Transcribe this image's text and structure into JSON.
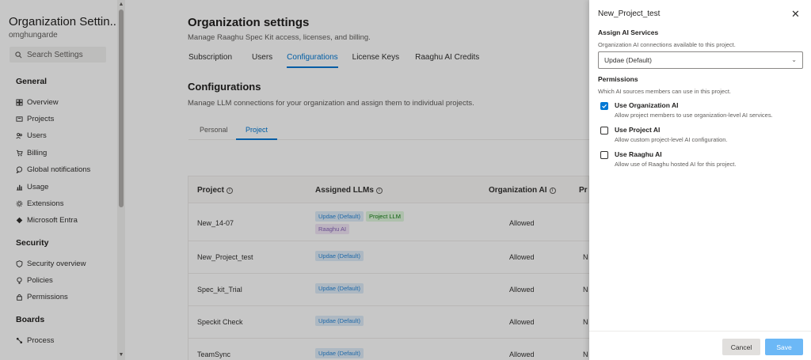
{
  "sidebar": {
    "title": "Organization Settin...",
    "subtitle": "omghungarde",
    "search_placeholder": "Search Settings",
    "sections": {
      "general": "General",
      "security": "Security",
      "boards": "Boards"
    },
    "general_items": [
      "Overview",
      "Projects",
      "Users",
      "Billing",
      "Global notifications",
      "Usage",
      "Extensions",
      "Microsoft Entra"
    ],
    "security_items": [
      "Security overview",
      "Policies",
      "Permissions"
    ],
    "boards_items": [
      "Process"
    ]
  },
  "main": {
    "title": "Organization settings",
    "subtitle": "Manage Raaghu Spec Kit access, licenses, and billing.",
    "tabs": [
      "Subscription",
      "Users",
      "Configurations",
      "License Keys",
      "Raaghu AI Credits"
    ],
    "active_tab": "Configurations",
    "section_title": "Configurations",
    "section_subtitle": "Manage LLM connections for your organization and assign them to individual projects.",
    "subtabs": [
      "Personal",
      "Project"
    ],
    "columns": [
      "Project",
      "Assigned LLMs",
      "Organization AI",
      "Pr"
    ],
    "rows": [
      {
        "name": "New_14-07",
        "tags": [
          {
            "text": "Updae (Default)",
            "color": "blue"
          },
          {
            "text": "Project LLM",
            "color": "green"
          },
          {
            "text": "Raaghu AI",
            "color": "purple"
          }
        ],
        "org_ai": "Allowed",
        "clip": ""
      },
      {
        "name": "New_Project_test",
        "tags": [
          {
            "text": "Updae (Default)",
            "color": "blue"
          }
        ],
        "org_ai": "Allowed",
        "clip": "N"
      },
      {
        "name": "Spec_kit_Trial",
        "tags": [
          {
            "text": "Updae (Default)",
            "color": "blue"
          }
        ],
        "org_ai": "Allowed",
        "clip": "N"
      },
      {
        "name": "Speckit Check",
        "tags": [
          {
            "text": "Updae (Default)",
            "color": "blue"
          }
        ],
        "org_ai": "Allowed",
        "clip": "N"
      },
      {
        "name": "TeamSync",
        "tags": [
          {
            "text": "Updae (Default)",
            "color": "blue"
          }
        ],
        "org_ai": "Allowed",
        "clip": "N"
      }
    ]
  },
  "panel": {
    "title": "New_Project_test",
    "assign_label": "Assign AI Services",
    "assign_help": "Organization AI connections available to this project.",
    "select_value": "Updae (Default)",
    "permissions_label": "Permissions",
    "permissions_help": "Which AI sources members can use in this project.",
    "options": [
      {
        "title": "Use Organization AI",
        "desc": "Allow project members to use organization-level AI services.",
        "checked": true
      },
      {
        "title": "Use Project AI",
        "desc": "Allow custom project-level AI configuration.",
        "checked": false
      },
      {
        "title": "Use Raaghu AI",
        "desc": "Allow use of Raaghu hosted AI for this project.",
        "checked": false
      }
    ],
    "cancel_label": "Cancel",
    "save_label": "Save"
  },
  "colors": {
    "accent": "#0078d4",
    "save_button": "#6cb8f6"
  }
}
